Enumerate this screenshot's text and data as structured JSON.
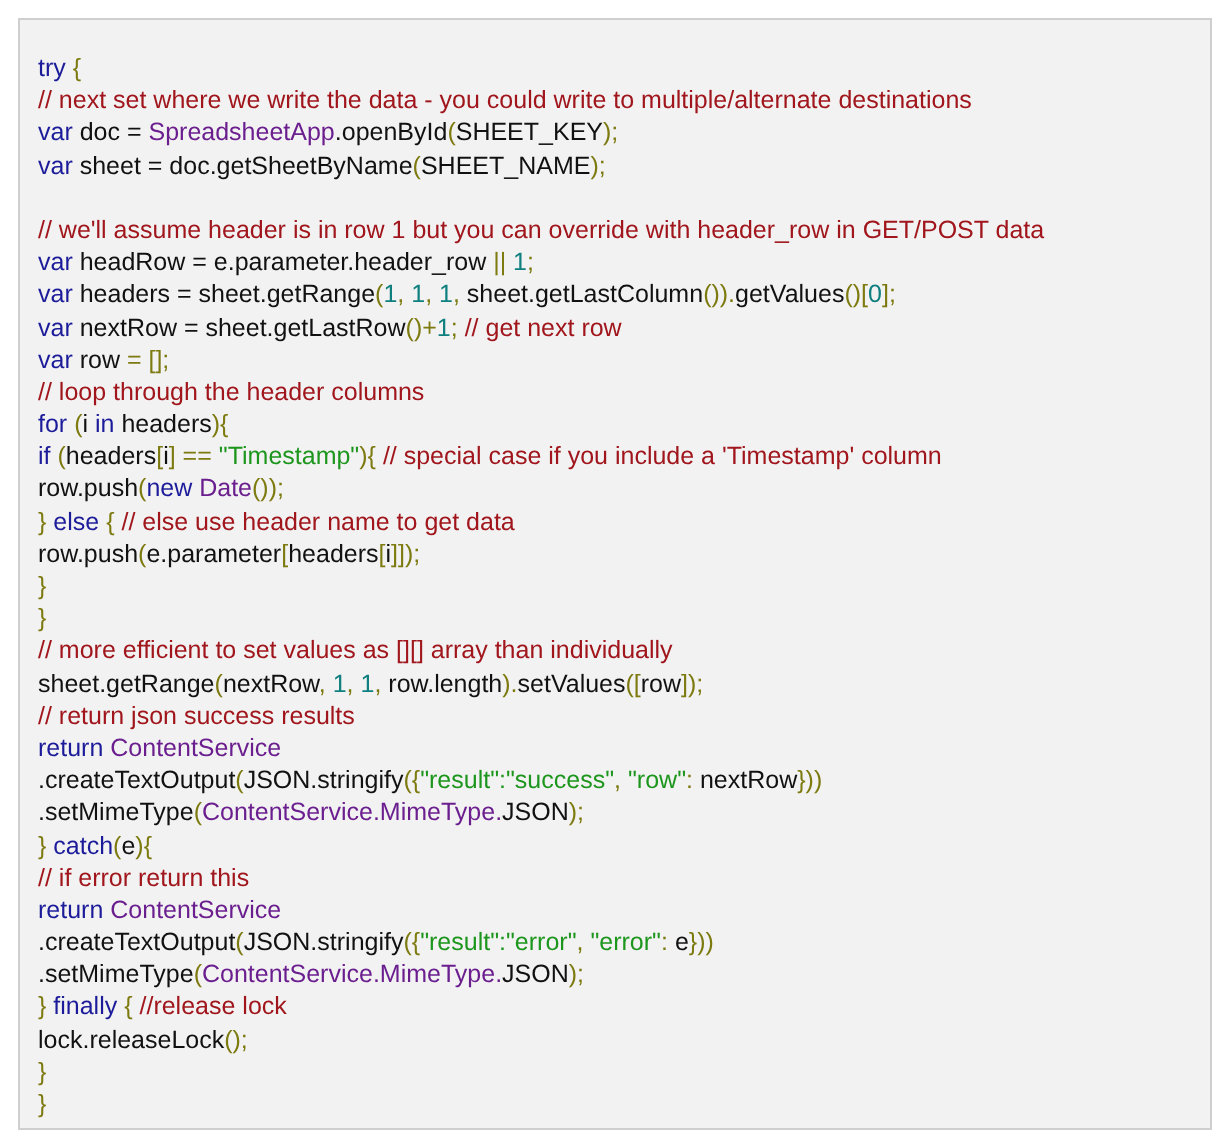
{
  "code_lines": [
    {
      "kind": "code",
      "tokens": [
        {
          "kind": "keyword",
          "text": "try"
        },
        {
          "kind": "punct",
          "text": " {"
        }
      ]
    },
    {
      "kind": "code",
      "tokens": [
        {
          "kind": "comment",
          "text": "// next set where we write the data - you could write to multiple/alternate destinations"
        }
      ]
    },
    {
      "kind": "code",
      "tokens": [
        {
          "kind": "keyword",
          "text": "var"
        },
        {
          "kind": "plain",
          "text": " doc = "
        },
        {
          "kind": "class",
          "text": "SpreadsheetApp"
        },
        {
          "kind": "plain",
          "text": ".openById"
        },
        {
          "kind": "punct",
          "text": "("
        },
        {
          "kind": "plain",
          "text": "SHEET_KEY"
        },
        {
          "kind": "punct",
          "text": ");"
        }
      ]
    },
    {
      "kind": "code",
      "tokens": [
        {
          "kind": "keyword",
          "text": "var"
        },
        {
          "kind": "plain",
          "text": " sheet = doc.getSheetByName"
        },
        {
          "kind": "punct",
          "text": "("
        },
        {
          "kind": "plain",
          "text": "SHEET_NAME"
        },
        {
          "kind": "punct",
          "text": ");"
        }
      ]
    },
    {
      "kind": "blank"
    },
    {
      "kind": "code",
      "tokens": [
        {
          "kind": "comment",
          "text": "// we'll assume header is in row 1 but you can override with header_row in GET/POST data"
        }
      ]
    },
    {
      "kind": "code",
      "tokens": [
        {
          "kind": "keyword",
          "text": "var"
        },
        {
          "kind": "plain",
          "text": " headRow = e.parameter.header_row "
        },
        {
          "kind": "punct",
          "text": "|| "
        },
        {
          "kind": "number",
          "text": "1"
        },
        {
          "kind": "punct",
          "text": ";"
        }
      ]
    },
    {
      "kind": "code",
      "tokens": [
        {
          "kind": "keyword",
          "text": "var"
        },
        {
          "kind": "plain",
          "text": " headers = sheet.getRange"
        },
        {
          "kind": "punct",
          "text": "("
        },
        {
          "kind": "number",
          "text": "1"
        },
        {
          "kind": "punct",
          "text": ", "
        },
        {
          "kind": "number",
          "text": "1"
        },
        {
          "kind": "punct",
          "text": ", "
        },
        {
          "kind": "number",
          "text": "1"
        },
        {
          "kind": "punct",
          "text": ", "
        },
        {
          "kind": "plain",
          "text": "sheet.getLastColumn"
        },
        {
          "kind": "punct",
          "text": "())."
        },
        {
          "kind": "plain",
          "text": "getValues"
        },
        {
          "kind": "punct",
          "text": "()["
        },
        {
          "kind": "number",
          "text": "0"
        },
        {
          "kind": "punct",
          "text": "];"
        }
      ]
    },
    {
      "kind": "code",
      "tokens": [
        {
          "kind": "keyword",
          "text": "var"
        },
        {
          "kind": "plain",
          "text": " nextRow = sheet.getLastRow"
        },
        {
          "kind": "punct",
          "text": "()+"
        },
        {
          "kind": "number",
          "text": "1"
        },
        {
          "kind": "punct",
          "text": "; "
        },
        {
          "kind": "comment",
          "text": "// get next row"
        }
      ]
    },
    {
      "kind": "code",
      "tokens": [
        {
          "kind": "keyword",
          "text": "var"
        },
        {
          "kind": "plain",
          "text": " row "
        },
        {
          "kind": "punct",
          "text": "= [];"
        }
      ]
    },
    {
      "kind": "code",
      "tokens": [
        {
          "kind": "comment",
          "text": "// loop through the header columns"
        }
      ]
    },
    {
      "kind": "code",
      "tokens": [
        {
          "kind": "keyword",
          "text": "for "
        },
        {
          "kind": "punct",
          "text": "("
        },
        {
          "kind": "plain",
          "text": "i "
        },
        {
          "kind": "keyword",
          "text": "in "
        },
        {
          "kind": "plain",
          "text": "headers"
        },
        {
          "kind": "punct",
          "text": "){"
        }
      ]
    },
    {
      "kind": "code",
      "tokens": [
        {
          "kind": "keyword",
          "text": "if "
        },
        {
          "kind": "punct",
          "text": "("
        },
        {
          "kind": "plain",
          "text": "headers"
        },
        {
          "kind": "punct",
          "text": "["
        },
        {
          "kind": "plain",
          "text": "i"
        },
        {
          "kind": "punct",
          "text": "] == "
        },
        {
          "kind": "string",
          "text": "\"Timestamp\""
        },
        {
          "kind": "punct",
          "text": "){ "
        },
        {
          "kind": "comment",
          "text": "// special case if you include a 'Timestamp' column"
        }
      ]
    },
    {
      "kind": "code",
      "tokens": [
        {
          "kind": "plain",
          "text": "row.push"
        },
        {
          "kind": "punct",
          "text": "("
        },
        {
          "kind": "keyword",
          "text": "new "
        },
        {
          "kind": "class",
          "text": "Date"
        },
        {
          "kind": "punct",
          "text": "());"
        }
      ]
    },
    {
      "kind": "code",
      "tokens": [
        {
          "kind": "punct",
          "text": "} "
        },
        {
          "kind": "keyword",
          "text": "else "
        },
        {
          "kind": "punct",
          "text": "{ "
        },
        {
          "kind": "comment",
          "text": "// else use header name to get data"
        }
      ]
    },
    {
      "kind": "code",
      "tokens": [
        {
          "kind": "plain",
          "text": "row.push"
        },
        {
          "kind": "punct",
          "text": "("
        },
        {
          "kind": "plain",
          "text": "e.parameter"
        },
        {
          "kind": "punct",
          "text": "["
        },
        {
          "kind": "plain",
          "text": "headers"
        },
        {
          "kind": "punct",
          "text": "["
        },
        {
          "kind": "plain",
          "text": "i"
        },
        {
          "kind": "punct",
          "text": "]]);"
        }
      ]
    },
    {
      "kind": "code",
      "tokens": [
        {
          "kind": "punct",
          "text": "}"
        }
      ]
    },
    {
      "kind": "code",
      "tokens": [
        {
          "kind": "punct",
          "text": "}"
        }
      ]
    },
    {
      "kind": "code",
      "tokens": [
        {
          "kind": "comment",
          "text": "// more efficient to set values as [][] array than individually"
        }
      ]
    },
    {
      "kind": "code",
      "tokens": [
        {
          "kind": "plain",
          "text": "sheet.getRange"
        },
        {
          "kind": "punct",
          "text": "("
        },
        {
          "kind": "plain",
          "text": "nextRow"
        },
        {
          "kind": "punct",
          "text": ", "
        },
        {
          "kind": "number",
          "text": "1"
        },
        {
          "kind": "punct",
          "text": ", "
        },
        {
          "kind": "number",
          "text": "1"
        },
        {
          "kind": "punct",
          "text": ", "
        },
        {
          "kind": "plain",
          "text": "row.length"
        },
        {
          "kind": "punct",
          "text": ")."
        },
        {
          "kind": "plain",
          "text": "setValues"
        },
        {
          "kind": "punct",
          "text": "(["
        },
        {
          "kind": "plain",
          "text": "row"
        },
        {
          "kind": "punct",
          "text": "]);"
        }
      ]
    },
    {
      "kind": "code",
      "tokens": [
        {
          "kind": "comment",
          "text": "// return json success results"
        }
      ]
    },
    {
      "kind": "code",
      "tokens": [
        {
          "kind": "keyword",
          "text": "return "
        },
        {
          "kind": "class",
          "text": "ContentService"
        }
      ]
    },
    {
      "kind": "code",
      "tokens": [
        {
          "kind": "plain",
          "text": ".createTextOutput"
        },
        {
          "kind": "punct",
          "text": "("
        },
        {
          "kind": "plain",
          "text": "JSON.stringify"
        },
        {
          "kind": "punct",
          "text": "({"
        },
        {
          "kind": "string",
          "text": "\"result\":\"success\""
        },
        {
          "kind": "punct",
          "text": ", "
        },
        {
          "kind": "string",
          "text": "\"row\""
        },
        {
          "kind": "punct",
          "text": ": "
        },
        {
          "kind": "plain",
          "text": "nextRow"
        },
        {
          "kind": "punct",
          "text": "}))"
        }
      ]
    },
    {
      "kind": "code",
      "tokens": [
        {
          "kind": "plain",
          "text": ".setMimeType"
        },
        {
          "kind": "punct",
          "text": "("
        },
        {
          "kind": "class",
          "text": "ContentService.MimeType."
        },
        {
          "kind": "plain",
          "text": "JSON"
        },
        {
          "kind": "punct",
          "text": ");"
        }
      ]
    },
    {
      "kind": "code",
      "tokens": [
        {
          "kind": "punct",
          "text": "} "
        },
        {
          "kind": "keyword",
          "text": "catch"
        },
        {
          "kind": "punct",
          "text": "("
        },
        {
          "kind": "plain",
          "text": "e"
        },
        {
          "kind": "punct",
          "text": "){"
        }
      ]
    },
    {
      "kind": "code",
      "tokens": [
        {
          "kind": "comment",
          "text": "// if error return this"
        }
      ]
    },
    {
      "kind": "code",
      "tokens": [
        {
          "kind": "keyword",
          "text": "return "
        },
        {
          "kind": "class",
          "text": "ContentService"
        }
      ]
    },
    {
      "kind": "code",
      "tokens": [
        {
          "kind": "plain",
          "text": ".createTextOutput"
        },
        {
          "kind": "punct",
          "text": "("
        },
        {
          "kind": "plain",
          "text": "JSON.stringify"
        },
        {
          "kind": "punct",
          "text": "({"
        },
        {
          "kind": "string",
          "text": "\"result\":\"error\""
        },
        {
          "kind": "punct",
          "text": ", "
        },
        {
          "kind": "string",
          "text": "\"error\""
        },
        {
          "kind": "punct",
          "text": ": "
        },
        {
          "kind": "plain",
          "text": "e"
        },
        {
          "kind": "punct",
          "text": "}))"
        }
      ]
    },
    {
      "kind": "code",
      "tokens": [
        {
          "kind": "plain",
          "text": ".setMimeType"
        },
        {
          "kind": "punct",
          "text": "("
        },
        {
          "kind": "class",
          "text": "ContentService.MimeType."
        },
        {
          "kind": "plain",
          "text": "JSON"
        },
        {
          "kind": "punct",
          "text": ");"
        }
      ]
    },
    {
      "kind": "code",
      "tokens": [
        {
          "kind": "punct",
          "text": "} "
        },
        {
          "kind": "keyword",
          "text": "finally "
        },
        {
          "kind": "punct",
          "text": "{ "
        },
        {
          "kind": "comment",
          "text": "//release lock"
        }
      ]
    },
    {
      "kind": "code",
      "tokens": [
        {
          "kind": "plain",
          "text": "lock.releaseLock"
        },
        {
          "kind": "punct",
          "text": "();"
        }
      ]
    },
    {
      "kind": "code",
      "tokens": [
        {
          "kind": "punct",
          "text": "}"
        }
      ]
    },
    {
      "kind": "code",
      "tokens": [
        {
          "kind": "punct",
          "text": "}"
        }
      ]
    }
  ]
}
